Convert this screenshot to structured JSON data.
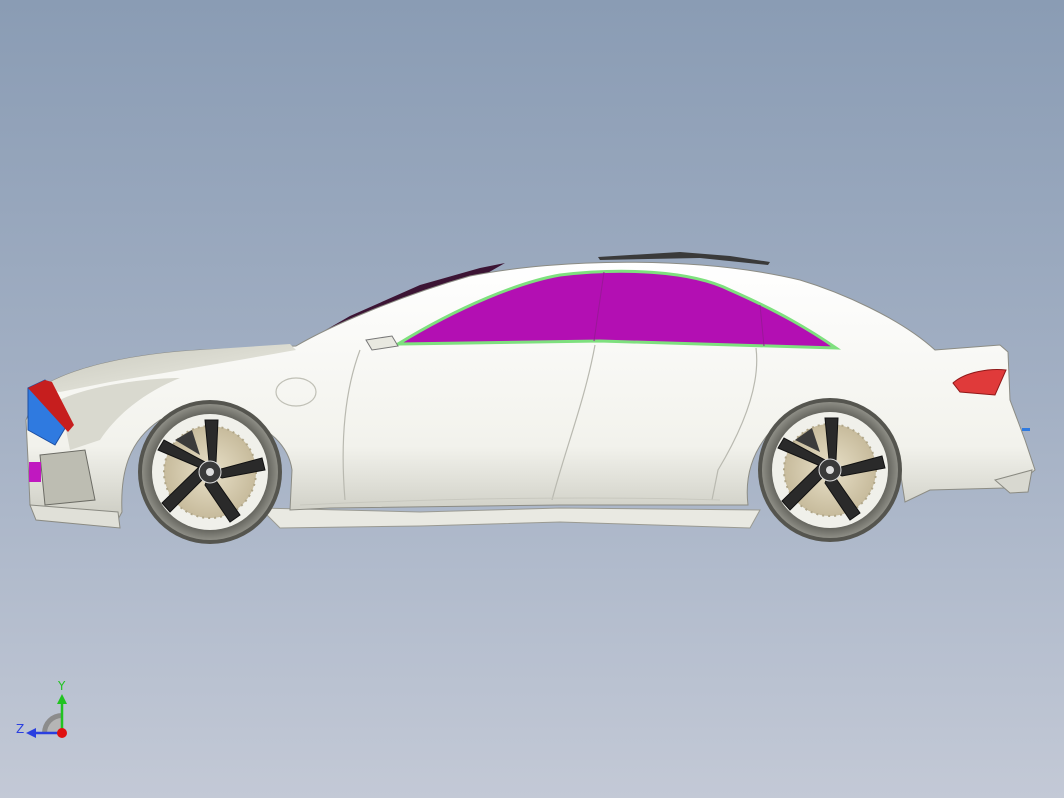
{
  "viewport": {
    "background_top": "#8a9cb4",
    "background_bottom": "#c3c9d6"
  },
  "model": {
    "body_color": "#f4f4ee",
    "window_color": "#b30fb3",
    "window_outline_color": "#7ee07e",
    "taillight_color": "#e03a3a",
    "headlight_color": "#2f7ae0",
    "wheel_color": "#2a2a2a"
  },
  "triad": {
    "y_label": "Y",
    "z_label": "Z",
    "y_color": "#21c321",
    "z_color": "#2a3fe0",
    "x_color": "#e01010"
  }
}
